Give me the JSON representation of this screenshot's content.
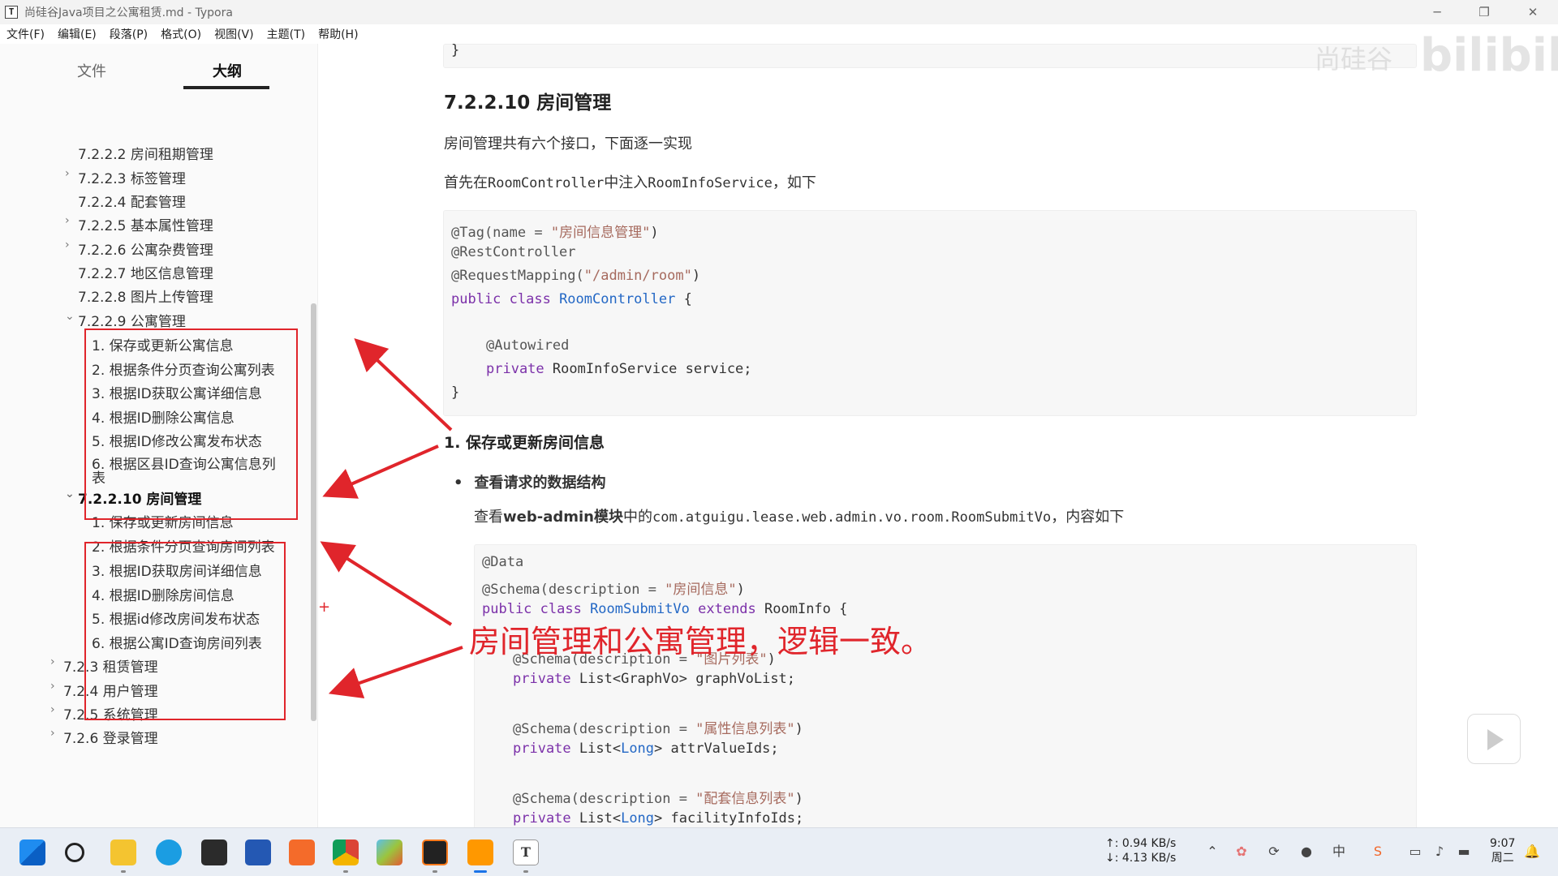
{
  "window": {
    "icon_letter": "T",
    "title": "尚硅谷Java项目之公寓租赁.md - Typora",
    "minimize": "─",
    "maximize": "❐",
    "close": "✕"
  },
  "menu": [
    "文件(F)",
    "编辑(E)",
    "段落(P)",
    "格式(O)",
    "视图(V)",
    "主题(T)",
    "帮助(H)"
  ],
  "sidebar": {
    "tabs": {
      "files": "文件",
      "outline": "大纲"
    },
    "outline": [
      {
        "label": "7.2.2.2 房间租期管理",
        "caret": ""
      },
      {
        "label": "7.2.2.3 标签管理",
        "caret": "›"
      },
      {
        "label": "7.2.2.4 配套管理",
        "caret": ""
      },
      {
        "label": "7.2.2.5 基本属性管理",
        "caret": "›"
      },
      {
        "label": "7.2.2.6 公寓杂费管理",
        "caret": "›"
      },
      {
        "label": "7.2.2.7 地区信息管理",
        "caret": ""
      },
      {
        "label": "7.2.2.8 图片上传管理",
        "caret": ""
      },
      {
        "label": "7.2.2.9 公寓管理",
        "caret": "⌄"
      },
      {
        "label": "1. 保存或更新公寓信息",
        "caret": ""
      },
      {
        "label": "2. 根据条件分页查询公寓列表",
        "caret": ""
      },
      {
        "label": "3. 根据ID获取公寓详细信息",
        "caret": ""
      },
      {
        "label": "4. 根据ID删除公寓信息",
        "caret": ""
      },
      {
        "label": "5. 根据ID修改公寓发布状态",
        "caret": ""
      },
      {
        "label": "6. 根据区县ID查询公寓信息列",
        "caret": ""
      },
      {
        "label": "表",
        "caret": ""
      },
      {
        "label": "7.2.2.10 房间管理",
        "caret": "⌄"
      },
      {
        "label": "1. 保存或更新房间信息",
        "caret": ""
      },
      {
        "label": "2. 根据条件分页查询房间列表",
        "caret": ""
      },
      {
        "label": "3. 根据ID获取房间详细信息",
        "caret": ""
      },
      {
        "label": "4. 根据ID删除房间信息",
        "caret": ""
      },
      {
        "label": "5. 根据id修改房间发布状态",
        "caret": ""
      },
      {
        "label": "6. 根据公寓ID查询房间列表",
        "caret": ""
      },
      {
        "label": "7.2.3 租赁管理",
        "caret": "›"
      },
      {
        "label": "7.2.4 用户管理",
        "caret": "›"
      },
      {
        "label": "7.2.5 系统管理",
        "caret": "›"
      },
      {
        "label": "7.2.6 登录管理",
        "caret": "›"
      }
    ]
  },
  "editor": {
    "top_brace": "}",
    "heading": "7.2.2.10 房间管理",
    "intro": "房间管理共有六个接口，下面逐一实现",
    "inject_prefix": "首先在",
    "inject_controller": "RoomController",
    "inject_mid": "中注入",
    "inject_service": "RoomInfoService",
    "inject_suffix": "，如下",
    "code1": {
      "l1_ann": "@Tag(name = ",
      "l1_str": "\"房间信息管理\"",
      "l1_end": ")",
      "l2": "@RestController",
      "l3_ann": "@RequestMapping(",
      "l3_str": "\"/admin/room\"",
      "l3_end": ")",
      "l4_kw": "public class ",
      "l4_cls": "RoomController",
      "l4_end": " {",
      "l5": "@Autowired",
      "l6_kw": "private ",
      "l6_rest": "RoomInfoService service;",
      "l7": "}"
    },
    "sub_heading": "1. 保存或更新房间信息",
    "bullet": "查看请求的数据结构",
    "detail_prefix": "查看",
    "detail_bold": "web-admin模块",
    "detail_mid": "中的",
    "detail_code": "com.atguigu.lease.web.admin.vo.room.RoomSubmitVo",
    "detail_suffix": "，内容如下",
    "code2": {
      "l1": "@Data",
      "l2_ann": "@Schema(description = ",
      "l2_str": "\"房间信息\"",
      "l2_end": ")",
      "l3_kw": "public class ",
      "l3_cls": "RoomSubmitVo",
      "l3_kw2": " extends ",
      "l3_end": "RoomInfo {",
      "l4_ann": "@Schema(description = ",
      "l4_str": "\"图片列表\"",
      "l4_end": ")",
      "l5_kw": "private ",
      "l5_a": "List<",
      "l5_b": "GraphVo",
      "l5_c": "> graphVoList;",
      "l6_ann": "@Schema(description = ",
      "l6_str": "\"属性信息列表\"",
      "l6_end": ")",
      "l7_kw": "private ",
      "l7_a": "List<",
      "l7_b": "Long",
      "l7_c": "> attrValueIds;",
      "l8_ann": "@Schema(description = ",
      "l8_str": "\"配套信息列表\"",
      "l8_end": ")",
      "l9_kw": "private ",
      "l9_a": "List<",
      "l9_b": "Long",
      "l9_c": "> facilityInfoIds;"
    }
  },
  "annotation": "房间管理和公寓管理，逻辑一致。",
  "plus_marker": "+",
  "watermark": "尚硅谷",
  "bili_logo": "bilibili",
  "taskbar": {
    "net_up": "↑: 0.94 KB/s",
    "net_down": "↓: 4.13 KB/s",
    "time": "9:07",
    "day": "周二",
    "ime": "中"
  },
  "colors": {
    "annotation_red": "#e0252b",
    "code_bg": "#f7f7f7"
  }
}
